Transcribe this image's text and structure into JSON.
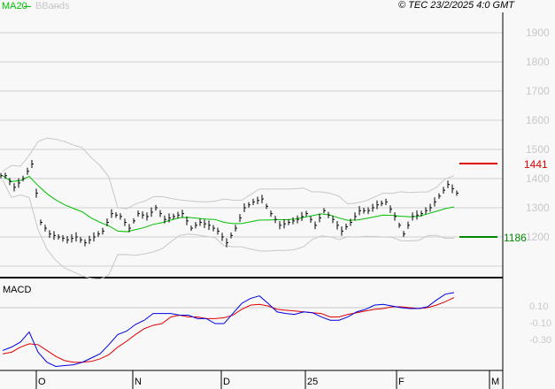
{
  "header": {
    "legend_ma": "MA20",
    "legend_bbands": "BBands",
    "copyright": "© TEC 23/2/2025 4:0 GMT"
  },
  "colors": {
    "ma": "#00c000",
    "bands": "#c8c8c8",
    "resistance": "#e00000",
    "support": "#008800",
    "macd": "#0000e0",
    "signal": "#e00000"
  },
  "chart_data": [
    {
      "type": "line",
      "title": "Price",
      "ylim": [
        1100,
        1950
      ],
      "y_ticks": [
        "1900",
        "1800",
        "1700",
        "1600",
        "1500",
        "1400",
        "1300",
        "1200"
      ],
      "y_tick_values": [
        1900,
        1800,
        1700,
        1600,
        1500,
        1400,
        1300,
        1200
      ],
      "x_ticks": [
        "O",
        "N",
        "D",
        "25",
        "F",
        "M"
      ],
      "closes": [
        1410,
        1370,
        1400,
        1450,
        1250,
        1210,
        1200,
        1190,
        1200,
        1180,
        1200,
        1220,
        1280,
        1270,
        1230,
        1280,
        1270,
        1300,
        1260,
        1270,
        1280,
        1230,
        1250,
        1240,
        1220,
        1180,
        1230,
        1300,
        1320,
        1330,
        1280,
        1240,
        1250,
        1260,
        1280,
        1240,
        1290,
        1260,
        1220,
        1250,
        1290,
        1290,
        1310,
        1320,
        1270,
        1210,
        1270,
        1280,
        1300,
        1340,
        1380,
        1350
      ],
      "resistance": {
        "value": 1441,
        "label": "1441"
      },
      "support": {
        "value": 1186,
        "label": "1186"
      }
    },
    {
      "type": "line",
      "title": "MACD",
      "ylim": [
        -0.7,
        0.4
      ],
      "y_ticks": [
        "0.10",
        "-0.10",
        "-0.30"
      ],
      "y_tick_values": [
        0.1,
        -0.1,
        -0.3
      ],
      "macd": [
        -0.41,
        -0.37,
        -0.31,
        -0.19,
        -0.43,
        -0.55,
        -0.6,
        -0.59,
        -0.58,
        -0.55,
        -0.5,
        -0.45,
        -0.34,
        -0.22,
        -0.18,
        -0.1,
        -0.05,
        0.03,
        0.03,
        0.03,
        0.01,
        0.01,
        -0.03,
        -0.03,
        -0.09,
        -0.09,
        0.03,
        0.15,
        0.21,
        0.24,
        0.15,
        0.05,
        0.03,
        0.02,
        0.05,
        0.04,
        -0.01,
        -0.05,
        -0.05,
        -0.01,
        0.05,
        0.08,
        0.13,
        0.14,
        0.12,
        0.1,
        0.09,
        0.09,
        0.11,
        0.19,
        0.26,
        0.28
      ],
      "signal": [
        -0.45,
        -0.43,
        -0.37,
        -0.33,
        -0.34,
        -0.41,
        -0.48,
        -0.53,
        -0.55,
        -0.55,
        -0.54,
        -0.51,
        -0.46,
        -0.37,
        -0.3,
        -0.22,
        -0.15,
        -0.11,
        -0.09,
        -0.01,
        0.01,
        -0.01,
        -0.01,
        -0.03,
        -0.03,
        -0.02,
        0.01,
        0.08,
        0.13,
        0.14,
        0.12,
        0.08,
        0.07,
        0.06,
        0.05,
        0.04,
        0.03,
        -0.01,
        -0.01,
        0.02,
        0.04,
        0.06,
        0.08,
        0.09,
        0.11,
        0.11,
        0.1,
        0.09,
        0.1,
        0.13,
        0.17,
        0.22
      ]
    }
  ]
}
